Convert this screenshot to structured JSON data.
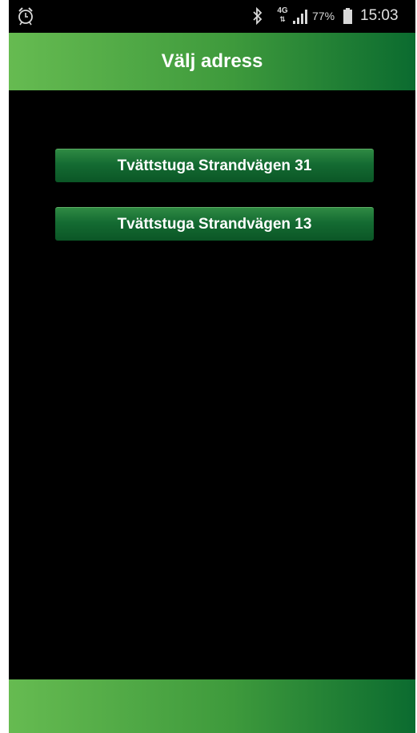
{
  "status_bar": {
    "alarm_icon": "alarm-clock-icon",
    "bluetooth_icon": "bluetooth-icon",
    "network_type": "4G",
    "signal_icon": "signal-strength-icon",
    "battery_percent": "77%",
    "battery_icon": "battery-icon",
    "time": "15:03"
  },
  "header": {
    "title": "Välj adress"
  },
  "addresses": [
    {
      "label": "Tvättstuga Strandvägen 31"
    },
    {
      "label": "Tvättstuga Strandvägen 13"
    }
  ],
  "colors": {
    "header_start": "#66bb51",
    "header_end": "#0b6b2f",
    "button": "#146b32",
    "background": "#000000"
  }
}
